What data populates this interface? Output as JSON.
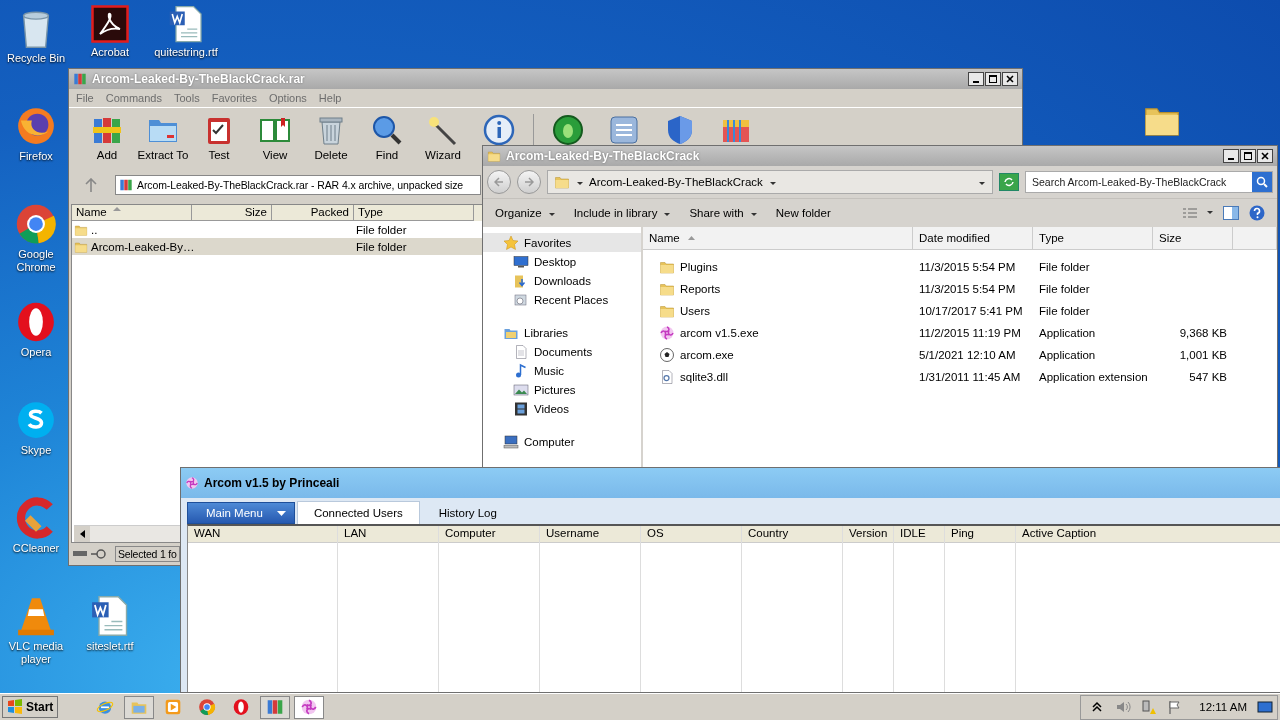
{
  "desktop_icons": [
    {
      "label": "Recycle Bin",
      "kind": "recycle"
    },
    {
      "label": "Acrobat",
      "kind": "acrobat"
    },
    {
      "label": "quitestring.rtf",
      "kind": "word"
    },
    {
      "label": "Firefox",
      "kind": "firefox"
    },
    {
      "label": "Google Chrome",
      "kind": "chrome"
    },
    {
      "label": "Opera",
      "kind": "opera"
    },
    {
      "label": "Skype",
      "kind": "skype"
    },
    {
      "label": "CCleaner",
      "kind": "ccleaner"
    },
    {
      "label": "VLC media player",
      "kind": "vlc"
    },
    {
      "label": "siteslet.rtf",
      "kind": "word"
    },
    {
      "kind": "folder"
    }
  ],
  "winrar": {
    "title": "Arcom-Leaked-By-TheBlackCrack.rar",
    "menu": [
      "File",
      "Commands",
      "Tools",
      "Favorites",
      "Options",
      "Help"
    ],
    "toolbar": [
      {
        "label": "Add",
        "kind": "add"
      },
      {
        "label": "Extract To",
        "kind": "extract"
      },
      {
        "label": "Test",
        "kind": "test"
      },
      {
        "label": "View",
        "kind": "view"
      },
      {
        "label": "Delete",
        "kind": "delete"
      },
      {
        "label": "Find",
        "kind": "find"
      },
      {
        "label": "Wizard",
        "kind": "wizard"
      },
      {
        "kind": "info"
      },
      {
        "kind": "bug"
      },
      {
        "kind": "list"
      },
      {
        "kind": "shield"
      },
      {
        "kind": "box"
      }
    ],
    "address": "Arcom-Leaked-By-TheBlackCrack.rar - RAR 4.x archive, unpacked size",
    "columns": [
      "Name",
      "Size",
      "Packed",
      "Type"
    ],
    "rows": [
      {
        "name": "..",
        "type": "File folder",
        "selected": false
      },
      {
        "name": "Arcom-Leaked-By…",
        "type": "File folder",
        "selected": true
      }
    ],
    "status": "Selected 1 fo"
  },
  "explorer": {
    "title": "Arcom-Leaked-By-TheBlackCrack",
    "path": "Arcom-Leaked-By-TheBlackCrack",
    "search": {
      "placeholder": "Search Arcom-Leaked-By-TheBlackCrack"
    },
    "commands": [
      "Organize",
      "Include in library",
      "Share with",
      "New folder"
    ],
    "nav": [
      {
        "label": "Favorites",
        "kind": "star",
        "selected": true,
        "children": [
          {
            "label": "Desktop",
            "kind": "desktop",
            "selected": false
          },
          {
            "label": "Downloads",
            "kind": "downloads",
            "selected": false
          },
          {
            "label": "Recent Places",
            "kind": "recent",
            "selected": false
          }
        ]
      },
      {
        "label": "Libraries",
        "kind": "library",
        "selected": false,
        "children": [
          {
            "label": "Documents",
            "kind": "documents",
            "selected": false
          },
          {
            "label": "Music",
            "kind": "music",
            "selected": false
          },
          {
            "label": "Pictures",
            "kind": "pictures",
            "selected": false
          },
          {
            "label": "Videos",
            "kind": "videos",
            "selected": false
          }
        ]
      },
      {
        "label": "Computer",
        "kind": "computer",
        "selected": false
      }
    ],
    "columns": [
      "Name",
      "Date modified",
      "Type",
      "Size"
    ],
    "files": [
      {
        "name": "Plugins",
        "date": "11/3/2015 5:54 PM",
        "type": "File folder",
        "kind": "folder"
      },
      {
        "name": "Reports",
        "date": "11/3/2015 5:54 PM",
        "type": "File folder",
        "kind": "folder"
      },
      {
        "name": "Users",
        "date": "10/17/2017 5:41 PM",
        "type": "File folder",
        "kind": "folder"
      },
      {
        "name": "arcom v1.5.exe",
        "date": "11/2/2015 11:19 PM",
        "type": "Application",
        "size": "9,368 KB",
        "kind": "swirl"
      },
      {
        "name": "arcom.exe",
        "date": "5/1/2021 12:10 AM",
        "type": "Application",
        "size": "1,001 KB",
        "kind": "ball"
      },
      {
        "name": "sqlite3.dll",
        "date": "1/31/2011 11:45 AM",
        "type": "Application extension",
        "size": "547 KB",
        "kind": "dll"
      }
    ]
  },
  "arcom": {
    "title": "Arcom v1.5 by Princeali",
    "tabs": [
      {
        "label": "Main Menu",
        "kind": "menu",
        "selected": false
      },
      {
        "label": "Connected Users",
        "kind": "tab",
        "selected": true
      },
      {
        "label": "History Log",
        "kind": "tab",
        "selected": false
      }
    ],
    "columns": [
      "WAN",
      "LAN",
      "Computer",
      "Username",
      "OS",
      "Country",
      "Version",
      "IDLE",
      "Ping",
      "Active Caption"
    ]
  },
  "taskbar": {
    "start": "Start",
    "apps": [
      {
        "kind": "ie",
        "running": false,
        "selected": false
      },
      {
        "kind": "explorer",
        "running": true,
        "selected": false
      },
      {
        "kind": "media",
        "running": false,
        "selected": false
      },
      {
        "kind": "chrome",
        "running": false,
        "selected": false
      },
      {
        "kind": "opera",
        "running": false,
        "selected": false
      },
      {
        "kind": "winrar",
        "running": true,
        "selected": false
      },
      {
        "kind": "swirl",
        "running": true,
        "selected": true
      }
    ],
    "clock": "12:11 AM"
  }
}
